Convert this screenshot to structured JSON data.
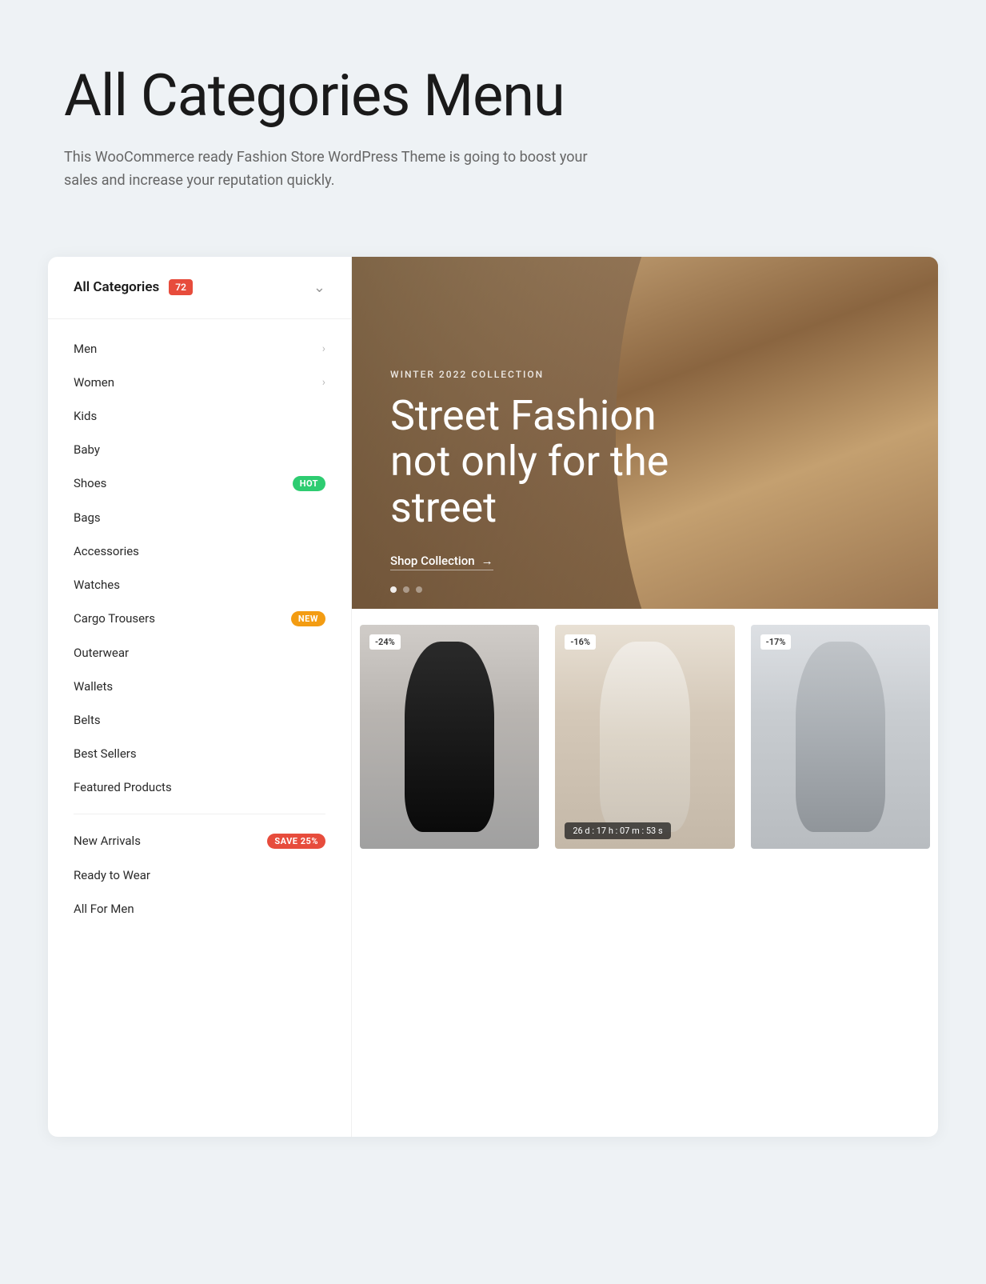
{
  "hero": {
    "title": "All Categories Menu",
    "subtitle": "This WooCommerce ready Fashion Store WordPress Theme is going to boost your sales and increase your reputation quickly."
  },
  "sidebar": {
    "title": "All Categories",
    "count": "72",
    "chevron": "∨",
    "categories_main": [
      {
        "id": "men",
        "label": "Men",
        "badge": null,
        "hasArrow": true
      },
      {
        "id": "women",
        "label": "Women",
        "badge": null,
        "hasArrow": true
      },
      {
        "id": "kids",
        "label": "Kids",
        "badge": null,
        "hasArrow": false
      },
      {
        "id": "baby",
        "label": "Baby",
        "badge": null,
        "hasArrow": false
      },
      {
        "id": "shoes",
        "label": "Shoes",
        "badge": "HOT",
        "badgeType": "hot",
        "hasArrow": false
      },
      {
        "id": "bags",
        "label": "Bags",
        "badge": null,
        "hasArrow": false
      },
      {
        "id": "accessories",
        "label": "Accessories",
        "badge": null,
        "hasArrow": false
      },
      {
        "id": "watches",
        "label": "Watches",
        "badge": null,
        "hasArrow": false
      },
      {
        "id": "cargo-trousers",
        "label": "Cargo Trousers",
        "badge": "NEW",
        "badgeType": "new",
        "hasArrow": false
      },
      {
        "id": "outerwear",
        "label": "Outerwear",
        "badge": null,
        "hasArrow": false
      },
      {
        "id": "wallets",
        "label": "Wallets",
        "badge": null,
        "hasArrow": false
      },
      {
        "id": "belts",
        "label": "Belts",
        "badge": null,
        "hasArrow": false
      },
      {
        "id": "best-sellers",
        "label": "Best Sellers",
        "badge": null,
        "hasArrow": false
      },
      {
        "id": "featured-products",
        "label": "Featured Products",
        "badge": null,
        "hasArrow": false
      }
    ],
    "categories_secondary": [
      {
        "id": "new-arrivals",
        "label": "New Arrivals",
        "badge": "SAVE 25%",
        "badgeType": "save",
        "hasArrow": false
      },
      {
        "id": "ready-to-wear",
        "label": "Ready to Wear",
        "badge": null,
        "hasArrow": false
      },
      {
        "id": "all-for-men",
        "label": "All For Men",
        "badge": null,
        "hasArrow": false
      }
    ]
  },
  "banner": {
    "subtitle": "WINTER 2022 COLLECTION",
    "title": "Street Fashion not only for the street",
    "cta": "Shop Collection",
    "cta_arrow": "→",
    "dots": [
      true,
      false,
      false
    ]
  },
  "products": [
    {
      "id": "product-1",
      "discount": "-24%",
      "style": "dark",
      "countdown": null
    },
    {
      "id": "product-2",
      "discount": "-16%",
      "style": "light",
      "countdown": "26 d : 17 h : 07 m : 53 s"
    },
    {
      "id": "product-3",
      "discount": "-17%",
      "style": "grey",
      "countdown": null
    }
  ]
}
